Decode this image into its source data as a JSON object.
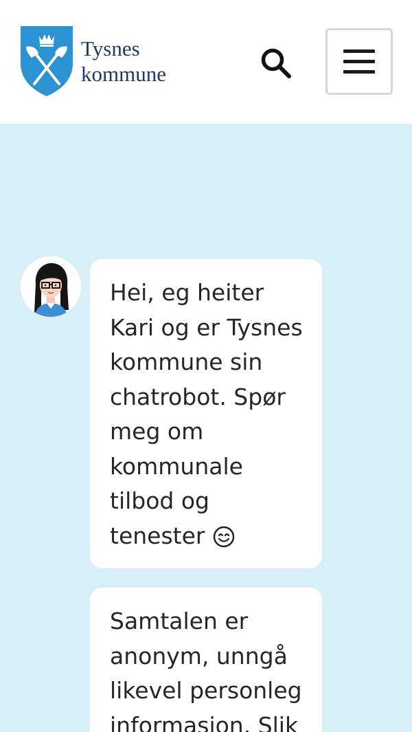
{
  "header": {
    "logo": {
      "line1": "Tysnes",
      "line2": "kommune"
    },
    "search_icon": "search-icon",
    "menu_icon": "hamburger-menu-icon"
  },
  "chat": {
    "avatar_icon": "chatbot-avatar",
    "messages": [
      {
        "text": "Hei, eg heiter Kari og er Tysnes kommune sin chatrobot. Spør meg om kommunale tilbod og tenester",
        "emoji": "smiling-face-icon"
      },
      {
        "text": "Samtalen er anonym, unngå likevel personleg informasjon. Slik"
      }
    ]
  },
  "colors": {
    "chat_background": "#d8eff8",
    "shield_blue": "#2b93d1",
    "logo_text": "#1d3a64",
    "bubble": "#ffffff"
  }
}
